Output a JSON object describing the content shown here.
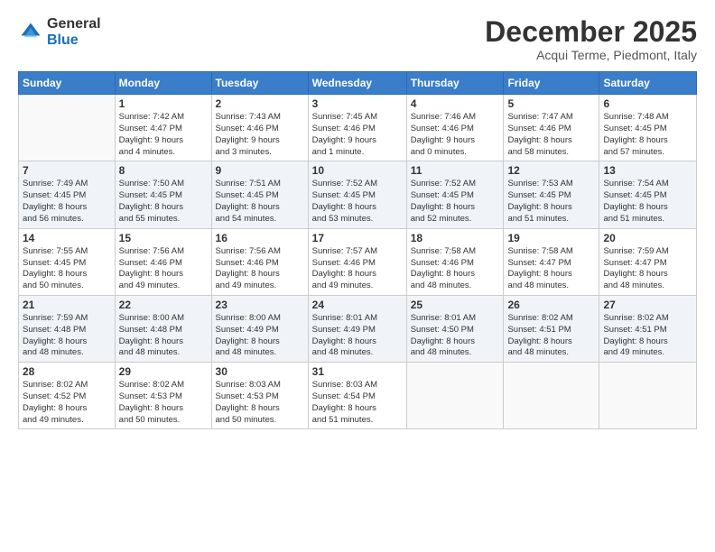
{
  "logo": {
    "general": "General",
    "blue": "Blue"
  },
  "title": "December 2025",
  "subtitle": "Acqui Terme, Piedmont, Italy",
  "days": [
    "Sunday",
    "Monday",
    "Tuesday",
    "Wednesday",
    "Thursday",
    "Friday",
    "Saturday"
  ],
  "weeks": [
    [
      {
        "num": "",
        "content": ""
      },
      {
        "num": "1",
        "content": "Sunrise: 7:42 AM\nSunset: 4:47 PM\nDaylight: 9 hours\nand 4 minutes."
      },
      {
        "num": "2",
        "content": "Sunrise: 7:43 AM\nSunset: 4:46 PM\nDaylight: 9 hours\nand 3 minutes."
      },
      {
        "num": "3",
        "content": "Sunrise: 7:45 AM\nSunset: 4:46 PM\nDaylight: 9 hours\nand 1 minute."
      },
      {
        "num": "4",
        "content": "Sunrise: 7:46 AM\nSunset: 4:46 PM\nDaylight: 9 hours\nand 0 minutes."
      },
      {
        "num": "5",
        "content": "Sunrise: 7:47 AM\nSunset: 4:46 PM\nDaylight: 8 hours\nand 58 minutes."
      },
      {
        "num": "6",
        "content": "Sunrise: 7:48 AM\nSunset: 4:45 PM\nDaylight: 8 hours\nand 57 minutes."
      }
    ],
    [
      {
        "num": "7",
        "content": "Sunrise: 7:49 AM\nSunset: 4:45 PM\nDaylight: 8 hours\nand 56 minutes."
      },
      {
        "num": "8",
        "content": "Sunrise: 7:50 AM\nSunset: 4:45 PM\nDaylight: 8 hours\nand 55 minutes."
      },
      {
        "num": "9",
        "content": "Sunrise: 7:51 AM\nSunset: 4:45 PM\nDaylight: 8 hours\nand 54 minutes."
      },
      {
        "num": "10",
        "content": "Sunrise: 7:52 AM\nSunset: 4:45 PM\nDaylight: 8 hours\nand 53 minutes."
      },
      {
        "num": "11",
        "content": "Sunrise: 7:52 AM\nSunset: 4:45 PM\nDaylight: 8 hours\nand 52 minutes."
      },
      {
        "num": "12",
        "content": "Sunrise: 7:53 AM\nSunset: 4:45 PM\nDaylight: 8 hours\nand 51 minutes."
      },
      {
        "num": "13",
        "content": "Sunrise: 7:54 AM\nSunset: 4:45 PM\nDaylight: 8 hours\nand 51 minutes."
      }
    ],
    [
      {
        "num": "14",
        "content": "Sunrise: 7:55 AM\nSunset: 4:45 PM\nDaylight: 8 hours\nand 50 minutes."
      },
      {
        "num": "15",
        "content": "Sunrise: 7:56 AM\nSunset: 4:46 PM\nDaylight: 8 hours\nand 49 minutes."
      },
      {
        "num": "16",
        "content": "Sunrise: 7:56 AM\nSunset: 4:46 PM\nDaylight: 8 hours\nand 49 minutes."
      },
      {
        "num": "17",
        "content": "Sunrise: 7:57 AM\nSunset: 4:46 PM\nDaylight: 8 hours\nand 49 minutes."
      },
      {
        "num": "18",
        "content": "Sunrise: 7:58 AM\nSunset: 4:46 PM\nDaylight: 8 hours\nand 48 minutes."
      },
      {
        "num": "19",
        "content": "Sunrise: 7:58 AM\nSunset: 4:47 PM\nDaylight: 8 hours\nand 48 minutes."
      },
      {
        "num": "20",
        "content": "Sunrise: 7:59 AM\nSunset: 4:47 PM\nDaylight: 8 hours\nand 48 minutes."
      }
    ],
    [
      {
        "num": "21",
        "content": "Sunrise: 7:59 AM\nSunset: 4:48 PM\nDaylight: 8 hours\nand 48 minutes."
      },
      {
        "num": "22",
        "content": "Sunrise: 8:00 AM\nSunset: 4:48 PM\nDaylight: 8 hours\nand 48 minutes."
      },
      {
        "num": "23",
        "content": "Sunrise: 8:00 AM\nSunset: 4:49 PM\nDaylight: 8 hours\nand 48 minutes."
      },
      {
        "num": "24",
        "content": "Sunrise: 8:01 AM\nSunset: 4:49 PM\nDaylight: 8 hours\nand 48 minutes."
      },
      {
        "num": "25",
        "content": "Sunrise: 8:01 AM\nSunset: 4:50 PM\nDaylight: 8 hours\nand 48 minutes."
      },
      {
        "num": "26",
        "content": "Sunrise: 8:02 AM\nSunset: 4:51 PM\nDaylight: 8 hours\nand 48 minutes."
      },
      {
        "num": "27",
        "content": "Sunrise: 8:02 AM\nSunset: 4:51 PM\nDaylight: 8 hours\nand 49 minutes."
      }
    ],
    [
      {
        "num": "28",
        "content": "Sunrise: 8:02 AM\nSunset: 4:52 PM\nDaylight: 8 hours\nand 49 minutes."
      },
      {
        "num": "29",
        "content": "Sunrise: 8:02 AM\nSunset: 4:53 PM\nDaylight: 8 hours\nand 50 minutes."
      },
      {
        "num": "30",
        "content": "Sunrise: 8:03 AM\nSunset: 4:53 PM\nDaylight: 8 hours\nand 50 minutes."
      },
      {
        "num": "31",
        "content": "Sunrise: 8:03 AM\nSunset: 4:54 PM\nDaylight: 8 hours\nand 51 minutes."
      },
      {
        "num": "",
        "content": ""
      },
      {
        "num": "",
        "content": ""
      },
      {
        "num": "",
        "content": ""
      }
    ]
  ]
}
